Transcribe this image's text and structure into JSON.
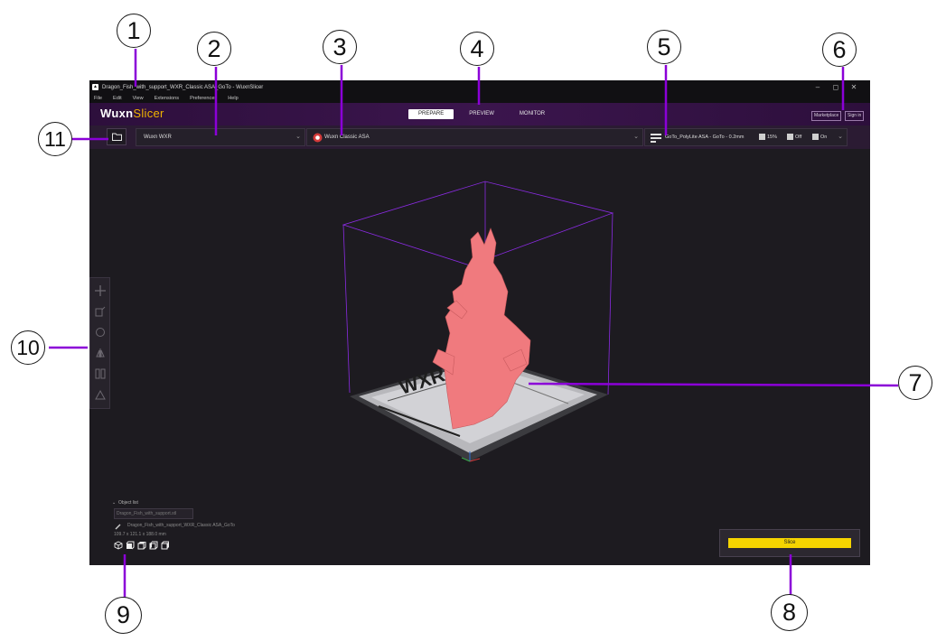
{
  "window": {
    "title": "Dragon_Fish_with_support_WXR_Classic ASA_GoTo - WuxnSlicer",
    "controls": [
      "–",
      "◻",
      "✕"
    ]
  },
  "menu": [
    "File",
    "Edit",
    "View",
    "Extensions",
    "Preferences",
    "Help"
  ],
  "header": {
    "logo_main": "Wuxn",
    "logo_accent": "Slicer",
    "tabs": [
      "PREPARE",
      "PREVIEW",
      "MONITOR"
    ],
    "active_tab": "PREPARE",
    "marketplace": "Marketplace",
    "signin": "Sign in"
  },
  "toolbar": {
    "printer": "Wuxn WXR",
    "material": "Wuxn Classic ASA",
    "profile": "GoTo_PolyLite ASA - GoTo - 0.2mm",
    "infill": "15%",
    "support": "Off",
    "adhesion": "On"
  },
  "object_panel": {
    "header": "Object list",
    "input_value": "Dragon_Fish_with_support.stl",
    "object_name": "Dragon_Fish_with_support_WXR_Classic ASA_GoTo",
    "dimensions": "109.7 x 121.1 x 188.0 mm"
  },
  "slice": {
    "label": "Slice"
  },
  "callouts": [
    "1",
    "2",
    "3",
    "4",
    "5",
    "6",
    "7",
    "8",
    "9",
    "10",
    "11"
  ],
  "colors": {
    "accent_purple": "#8b00d8",
    "header_bg": "#3b154d",
    "slice_yellow": "#f5d400",
    "model_pink": "#f07a7e"
  },
  "icons": [
    "folder-icon",
    "move-icon",
    "scale-icon",
    "rotate-icon",
    "mirror-icon",
    "per-model-settings-icon",
    "support-blocker-icon",
    "3d-view-icon",
    "front-view-icon",
    "top-view-icon",
    "left-view-icon",
    "right-view-icon"
  ]
}
